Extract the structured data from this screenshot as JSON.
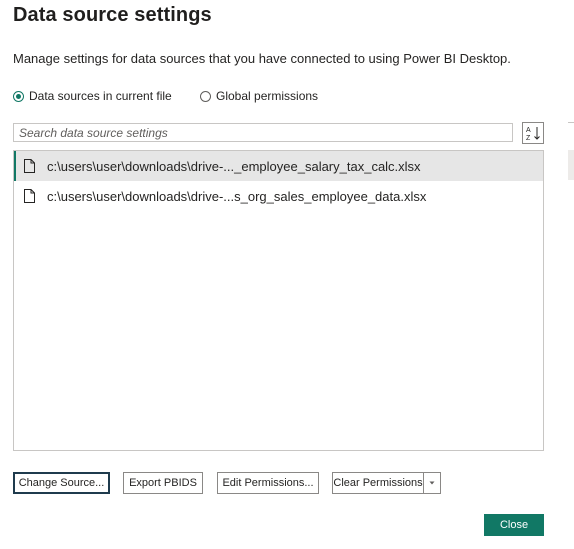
{
  "dialog": {
    "title": "Data source settings",
    "description": "Manage settings for data sources that you have connected to using Power BI Desktop."
  },
  "scope": {
    "options": [
      {
        "label": "Data sources in current file",
        "checked": true
      },
      {
        "label": "Global permissions",
        "checked": false
      }
    ]
  },
  "search": {
    "placeholder": "Search data source settings",
    "value": ""
  },
  "sort": {
    "icon": "sort-az-icon"
  },
  "sources": [
    {
      "path": "c:\\users\\user\\downloads\\drive-..._employee_salary_tax_calc.xlsx",
      "icon": "file-icon",
      "selected": true
    },
    {
      "path": "c:\\users\\user\\downloads\\drive-...s_org_sales_employee_data.xlsx",
      "icon": "file-icon",
      "selected": false
    }
  ],
  "actions": {
    "change_source": "Change Source...",
    "export_pbids": "Export PBIDS",
    "edit_permissions": "Edit Permissions...",
    "clear_permissions": "Clear Permissions",
    "close": "Close"
  },
  "colors": {
    "accent": "#117865",
    "focus_border": "#1f3b4d",
    "selected_row": "#e6e6e6"
  }
}
